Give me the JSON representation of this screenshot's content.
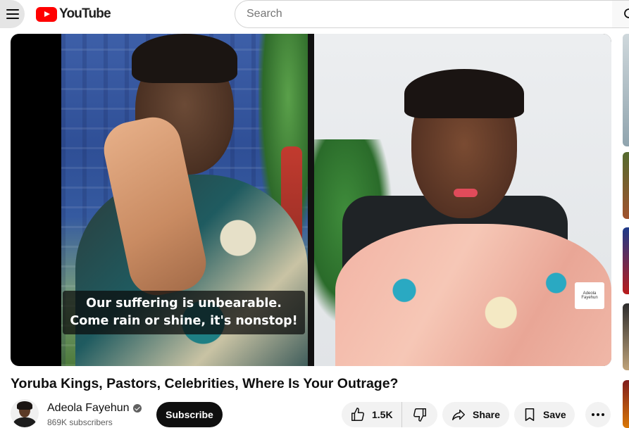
{
  "header": {
    "logo_text": "YouTube",
    "search": {
      "placeholder": "Search",
      "value": ""
    }
  },
  "video": {
    "captions": [
      "Our suffering is unbearable.",
      "Come rain or shine, it's nonstop!"
    ],
    "watermark": "Adeola Fayehun"
  },
  "meta": {
    "title": "Yoruba Kings, Pastors, Celebrities, Where Is Your Outrage?",
    "channel": {
      "name": "Adeola Fayehun",
      "subscribers": "869K subscribers",
      "verified": true
    },
    "subscribe_label": "Subscribe",
    "actions": {
      "likes": "1.5K",
      "share_label": "Share",
      "save_label": "Save"
    }
  },
  "colors": {
    "brand_red": "#ff0000",
    "text_primary": "#0f0f0f",
    "text_secondary": "#606060",
    "pill_bg": "#f2f2f2"
  },
  "icons": [
    "menu-icon",
    "youtube-logo-icon",
    "search-icon",
    "verified-icon",
    "thumbs-up-icon",
    "thumbs-down-icon",
    "share-icon",
    "save-icon",
    "more-icon"
  ]
}
